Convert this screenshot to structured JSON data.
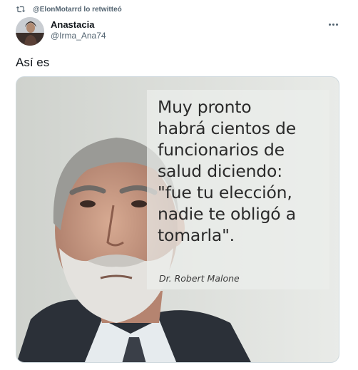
{
  "retweet": {
    "icon": "retweet-icon",
    "text": "@ElonMotarrd lo retwitteó"
  },
  "author": {
    "name": "Anastacia",
    "handle": "@Irma_Ana74",
    "avatar_icon": "avatar"
  },
  "tweet": {
    "text": "Así es"
  },
  "media": {
    "quote": "Muy pronto\nhabrá cientos de\nfuncionarios de\nsalud diciendo:\n\"fue tu elección,\nnadie te obligó a\ntomarla\".",
    "attribution": "Dr. Robert Malone"
  },
  "colors": {
    "text_primary": "#0f1419",
    "text_secondary": "#536471",
    "border": "#cfd9de"
  }
}
